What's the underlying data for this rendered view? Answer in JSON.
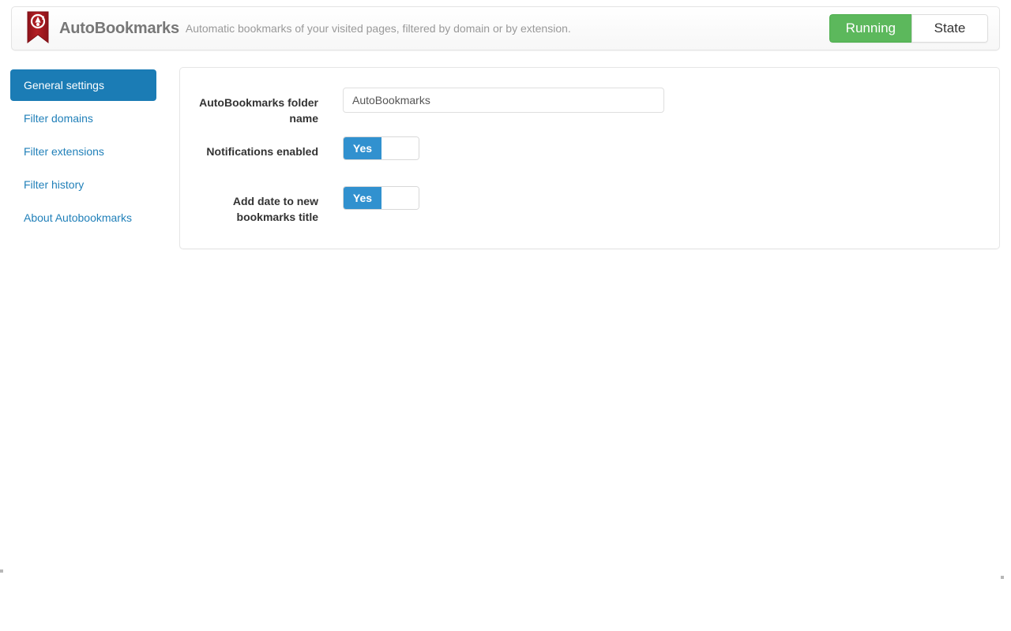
{
  "header": {
    "logo_icon": "bookmark-ribbon-icon",
    "title": "AutoBookmarks",
    "subtitle": "Automatic bookmarks of your visited pages, filtered by domain or by extension.",
    "state_running_label": "Running",
    "state_label": "State",
    "running_color": "#5cb85c"
  },
  "sidebar": {
    "items": [
      {
        "label": "General settings",
        "active": true
      },
      {
        "label": "Filter domains",
        "active": false
      },
      {
        "label": "Filter extensions",
        "active": false
      },
      {
        "label": "Filter history",
        "active": false
      },
      {
        "label": "About Autobookmarks",
        "active": false
      }
    ],
    "active_color": "#1b7cb5",
    "link_color": "#2180b9"
  },
  "settings_form": {
    "rows": [
      {
        "label": "AutoBookmarks folder name",
        "type": "text",
        "value": "AutoBookmarks",
        "placeholder": "AutoBookmarks"
      },
      {
        "label": "Notifications enabled",
        "type": "toggle",
        "value": "Yes"
      },
      {
        "label": "Add date to new bookmarks title",
        "type": "toggle",
        "value": "Yes"
      }
    ],
    "toggle_on_color": "#3191cf"
  }
}
